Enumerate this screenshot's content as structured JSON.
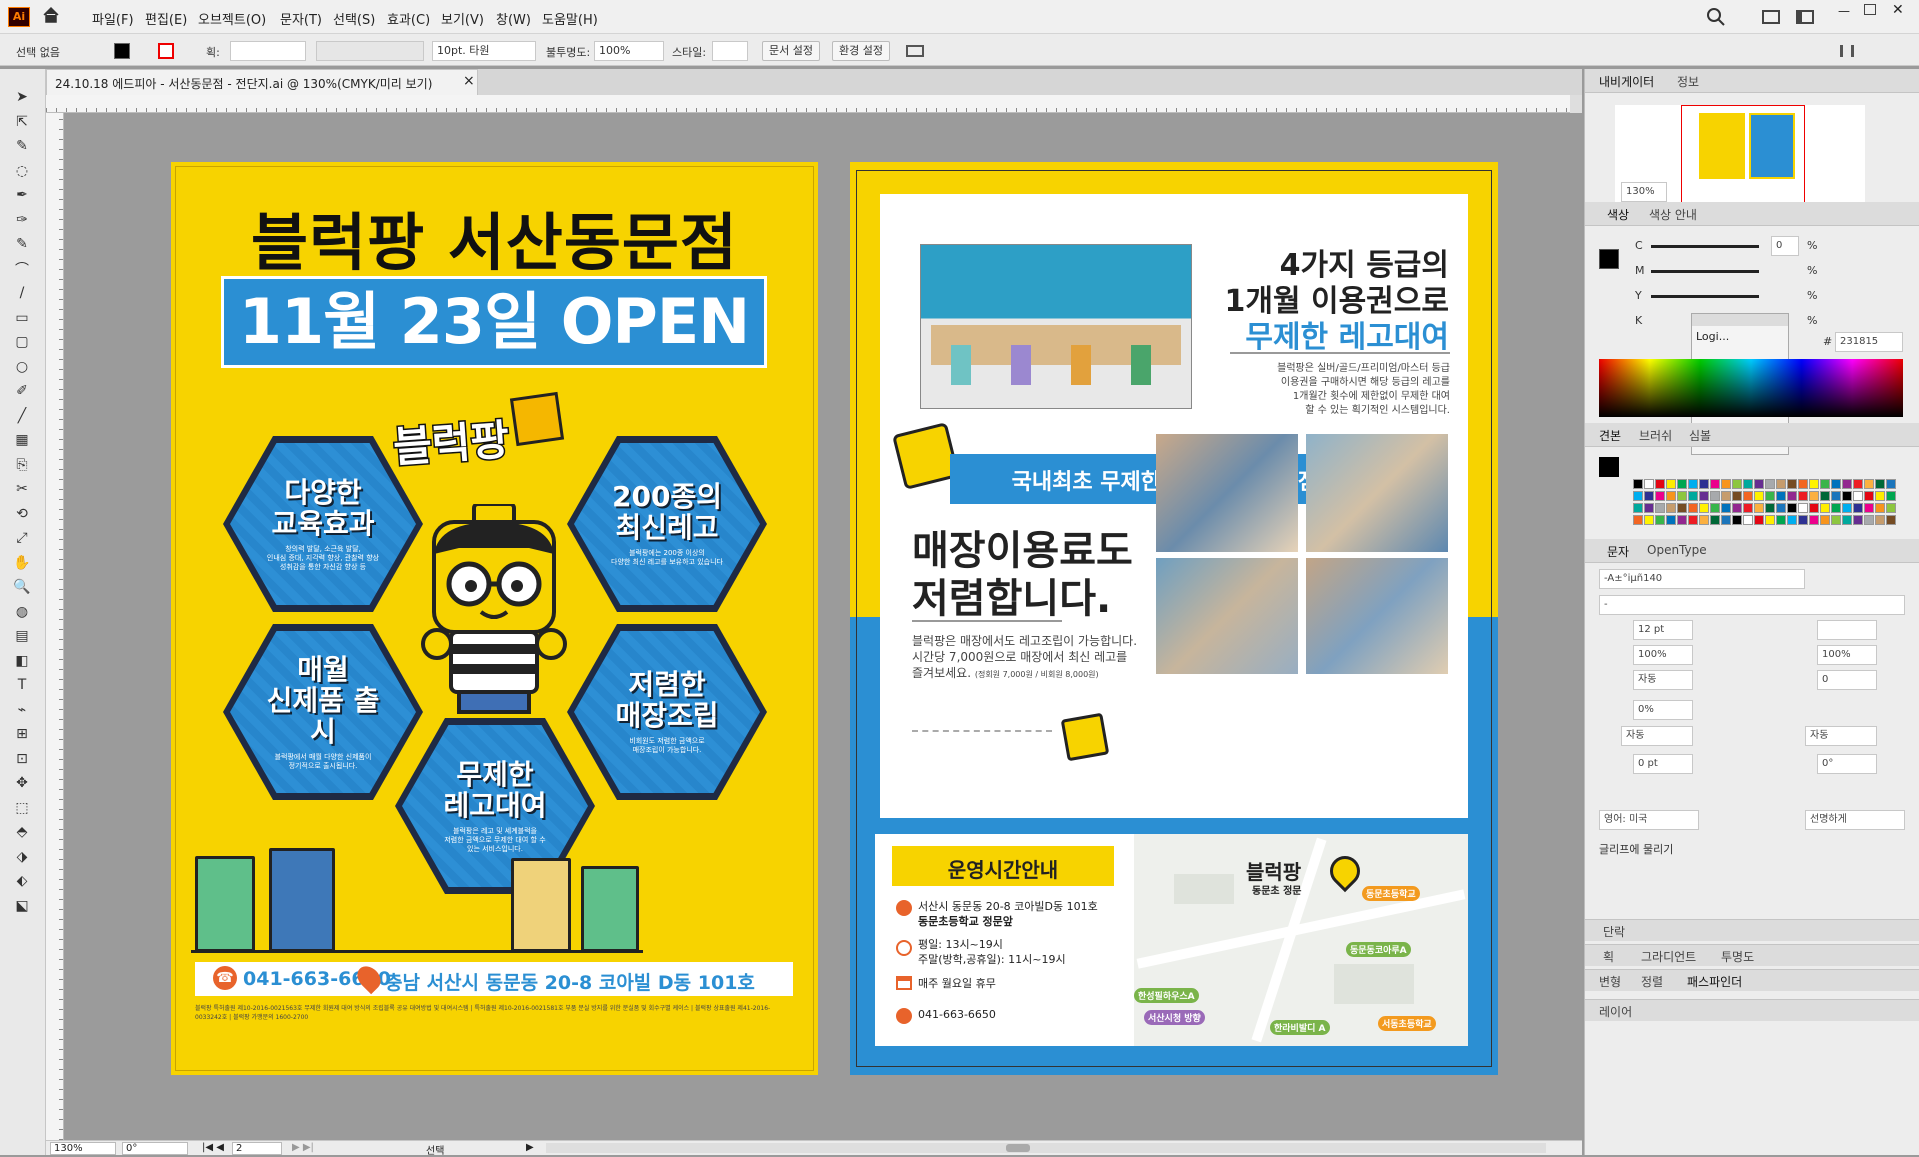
{
  "app": {
    "logo": "Ai",
    "brand_color": "#ff7c00",
    "menu": [
      "파일(F)",
      "편집(E)",
      "오브젝트(O)",
      "문자(T)",
      "선택(S)",
      "효과(C)",
      "보기(V)",
      "창(W)",
      "도움말(H)"
    ]
  },
  "control": {
    "selection": "선택 없음",
    "stroke_label": "획:",
    "brush": "10pt. 타원",
    "opacity_label": "불투명도:",
    "opacity": "100%",
    "style_label": "스타일:",
    "doc_setup": "문서 설정",
    "prefs": "환경 설정"
  },
  "document": {
    "tab_title": "24.10.18 에드피아 - 서산동문점 - 전단지.ai @ 130%(CMYK/미리 보기)",
    "close": "×"
  },
  "status": {
    "zoom": "130%",
    "rotation": "0°",
    "artboard": "2",
    "tool": "선택"
  },
  "flyer1": {
    "title": "블럭팡 서산동문점",
    "banner": "11월 23일 OPEN",
    "logo": "블럭팡",
    "hexes": [
      {
        "title": "다양한\n교육효과",
        "desc": "창의력 발달, 소근육 발달,\n인내심 증대, 지각력 향상, 관찰력 향상\n성취감을 통한 자신감 향상 등"
      },
      {
        "title": "200종의\n최신레고",
        "desc": "블럭팡에는 200종 이상의\n다양한 최신 레고를 보유하고 있습니다"
      },
      {
        "title": "매월\n신제품 출시",
        "desc": "블럭팡에서 매월 다양한 신제품이\n정기적으로 출시됩니다."
      },
      {
        "title": "저렴한\n매장조립",
        "desc": "비회원도 저렴한 금액으로\n매장조립이 가능합니다."
      },
      {
        "title": "무제한\n레고대여",
        "desc": "블럭팡은 레고 및 세계블럭을\n저렴한 금액으로 무제한 대여 할 수\n있는 서비스입니다."
      }
    ],
    "phone": "041-663-6650",
    "address": "충남 서산시 동문동 20-8 코아빌 D동 101호",
    "fine_print": "블럭팡 특허출원 제10-2016-0021563호 무제한 회원제 대여 방식의 조립블록 공유 대여방법 및 대여시스템 | 특허출원 제10-2016-0021581호 부품 분실 방지를 위한 분실품 및 회수구별 케이스 | 블럭팡 상표출원 제41-2016-0033242호 | 블럭팡 가맹문의 1600-2700"
  },
  "flyer2": {
    "headline1": "4가지 등급의",
    "headline2": "1개월 이용권으로",
    "headline3": "무제한 레고대여",
    "grade_desc": "블럭팡은 실버/골드/프리미엄/마스터 등급\n이용권을 구매하시면 해당 등급의 레고를\n1개월간 횟수에 제한없이 무제한 대여\n할 수 있는 획기적인 시스템입니다.",
    "banner": "국내최초 무제한 레고대여 전문점 블럭팡",
    "fee_title1": "매장이용료도",
    "fee_title2": "저렴합니다.",
    "fee_desc1": "블럭팡은 매장에서도 레고조립이 가능합니다.",
    "fee_desc2": "시간당 7,000원으로 매장에서 최신 레고를",
    "fee_desc3": "즐겨보세요.",
    "fee_note": "(정회원 7,000원 / 비회원 8,000원)",
    "hours_title": "운영시간안내",
    "address1": "서산시 동문동 20-8 코아빌D동 101호",
    "address2": "동문초등학교 정문앞",
    "hours1": "평일: 13시~19시",
    "hours2": "주말(방학,공휴일): 11시~19시",
    "closed": "매주 월요일 휴무",
    "phone": "041-663-6650",
    "map_brand": "블럭팡",
    "map_sub": "동문초 정문",
    "map_labels": [
      "동문초등학교",
      "동문동코아루A",
      "한성필하우스A",
      "서산시청 방향",
      "한라비발디 A",
      "서동초등학교"
    ]
  },
  "panels": {
    "nav_tabs": [
      "내비게이터",
      "정보"
    ],
    "nav_zoom": "130%",
    "color_tabs": [
      "색상",
      "색상 안내"
    ],
    "color_channels": [
      "C",
      "M",
      "Y",
      "K"
    ],
    "color_values": [
      "0",
      "",
      "",
      ""
    ],
    "percent": "%",
    "hex_label": "#",
    "hex_value": "231815",
    "popup_text": "Logi...",
    "swatch_tabs": [
      "견본",
      "브러쉬",
      "심볼"
    ],
    "char_tabs": [
      "문자",
      "OpenType"
    ],
    "font_name": "-A±°iµñ140",
    "font_style": "-",
    "font_size": "12 pt",
    "leading": "",
    "hscale": "100%",
    "vscale": "100%",
    "tracking": "자동",
    "kerning": "0",
    "tsume": "0%",
    "aki1": "자동",
    "aki2": "자동",
    "baseline": "0 pt",
    "rotate": "0°",
    "lang": "영어: 미국",
    "aa": "선명하게",
    "snap_label": "글리프에 물리기",
    "para_hdr": "단락",
    "stroke_tabs": [
      "획",
      "그라디언트",
      "투명도"
    ],
    "transform_tabs": [
      "변형",
      "정렬",
      "패스파인더"
    ],
    "layers_tab": "레이어"
  },
  "swatch_colors": [
    "#000000",
    "#ffffff",
    "#e30613",
    "#ffed00",
    "#00a650",
    "#00aeef",
    "#2e3192",
    "#ec008c",
    "#f7941d",
    "#8dc63f",
    "#00a99d",
    "#662d91",
    "#a7a9ac",
    "#c69c6d",
    "#754c24",
    "#f26522",
    "#fff200",
    "#39b54a",
    "#0072bc",
    "#92278f",
    "#ed1c24",
    "#fbb040",
    "#006838",
    "#1b75bb"
  ]
}
